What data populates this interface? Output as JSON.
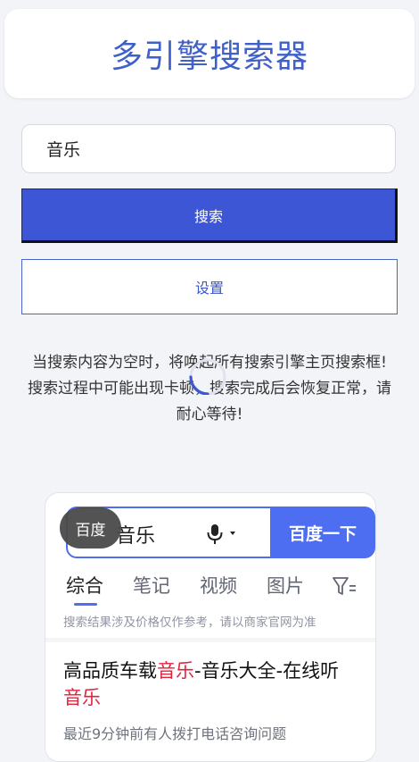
{
  "app": {
    "title": "多引擎搜索器"
  },
  "search": {
    "query": "音乐",
    "search_button": "搜索",
    "settings_button": "设置"
  },
  "notice": {
    "line1": "当搜索内容为空时，将唤起所有搜索引擎主页搜索框!",
    "line2": "搜索过程中可能出现卡顿，搜索完成后会恢复正常，请耐心等待!"
  },
  "preview": {
    "engine_tag": "百度",
    "query": "音乐",
    "search_button": "百度一下",
    "tabs": [
      {
        "label": "综合",
        "active": true
      },
      {
        "label": "笔记",
        "active": false
      },
      {
        "label": "视频",
        "active": false
      },
      {
        "label": "图片",
        "active": false
      }
    ],
    "disclaimer": "搜索结果涉及价格仅作参考，请以商家官网为准",
    "result": {
      "title_part1": "高品质车载",
      "title_highlight1": "音乐",
      "title_part2": "-音乐大全-在线听",
      "title_highlight2": "音乐",
      "meta": "最近9分钟前有人拨打电话咨询问题"
    }
  },
  "colors": {
    "title": "#3f5fc9",
    "primary": "#3c56d6",
    "baidu_blue": "#4e6ef2",
    "highlight_red": "#e0223b"
  },
  "icons": {
    "spinner": "loading-spinner-icon",
    "mic": "microphone-icon",
    "filter": "filter-icon"
  }
}
